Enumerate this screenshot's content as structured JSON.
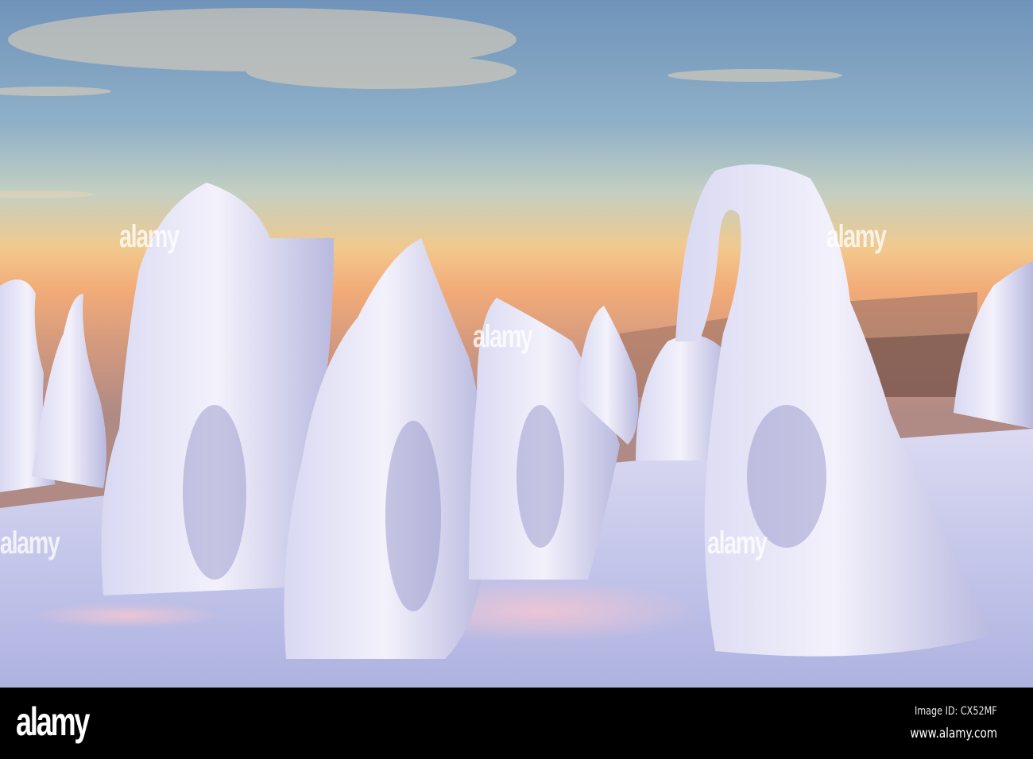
{
  "footer": {
    "logo": "alamy",
    "image_id": "Image ID: CX52MF",
    "url": "www.alamy.com"
  },
  "watermark": "alamy",
  "colors": {
    "sky_top": "#6f93ba",
    "sky_mid": "#b9c9c6",
    "horizon": "#f2b27a",
    "haze": "#c79a7c",
    "snow": "#e9e7f6",
    "snow_shadow": "#9fa3d2",
    "ground": "#c9cbeb"
  }
}
